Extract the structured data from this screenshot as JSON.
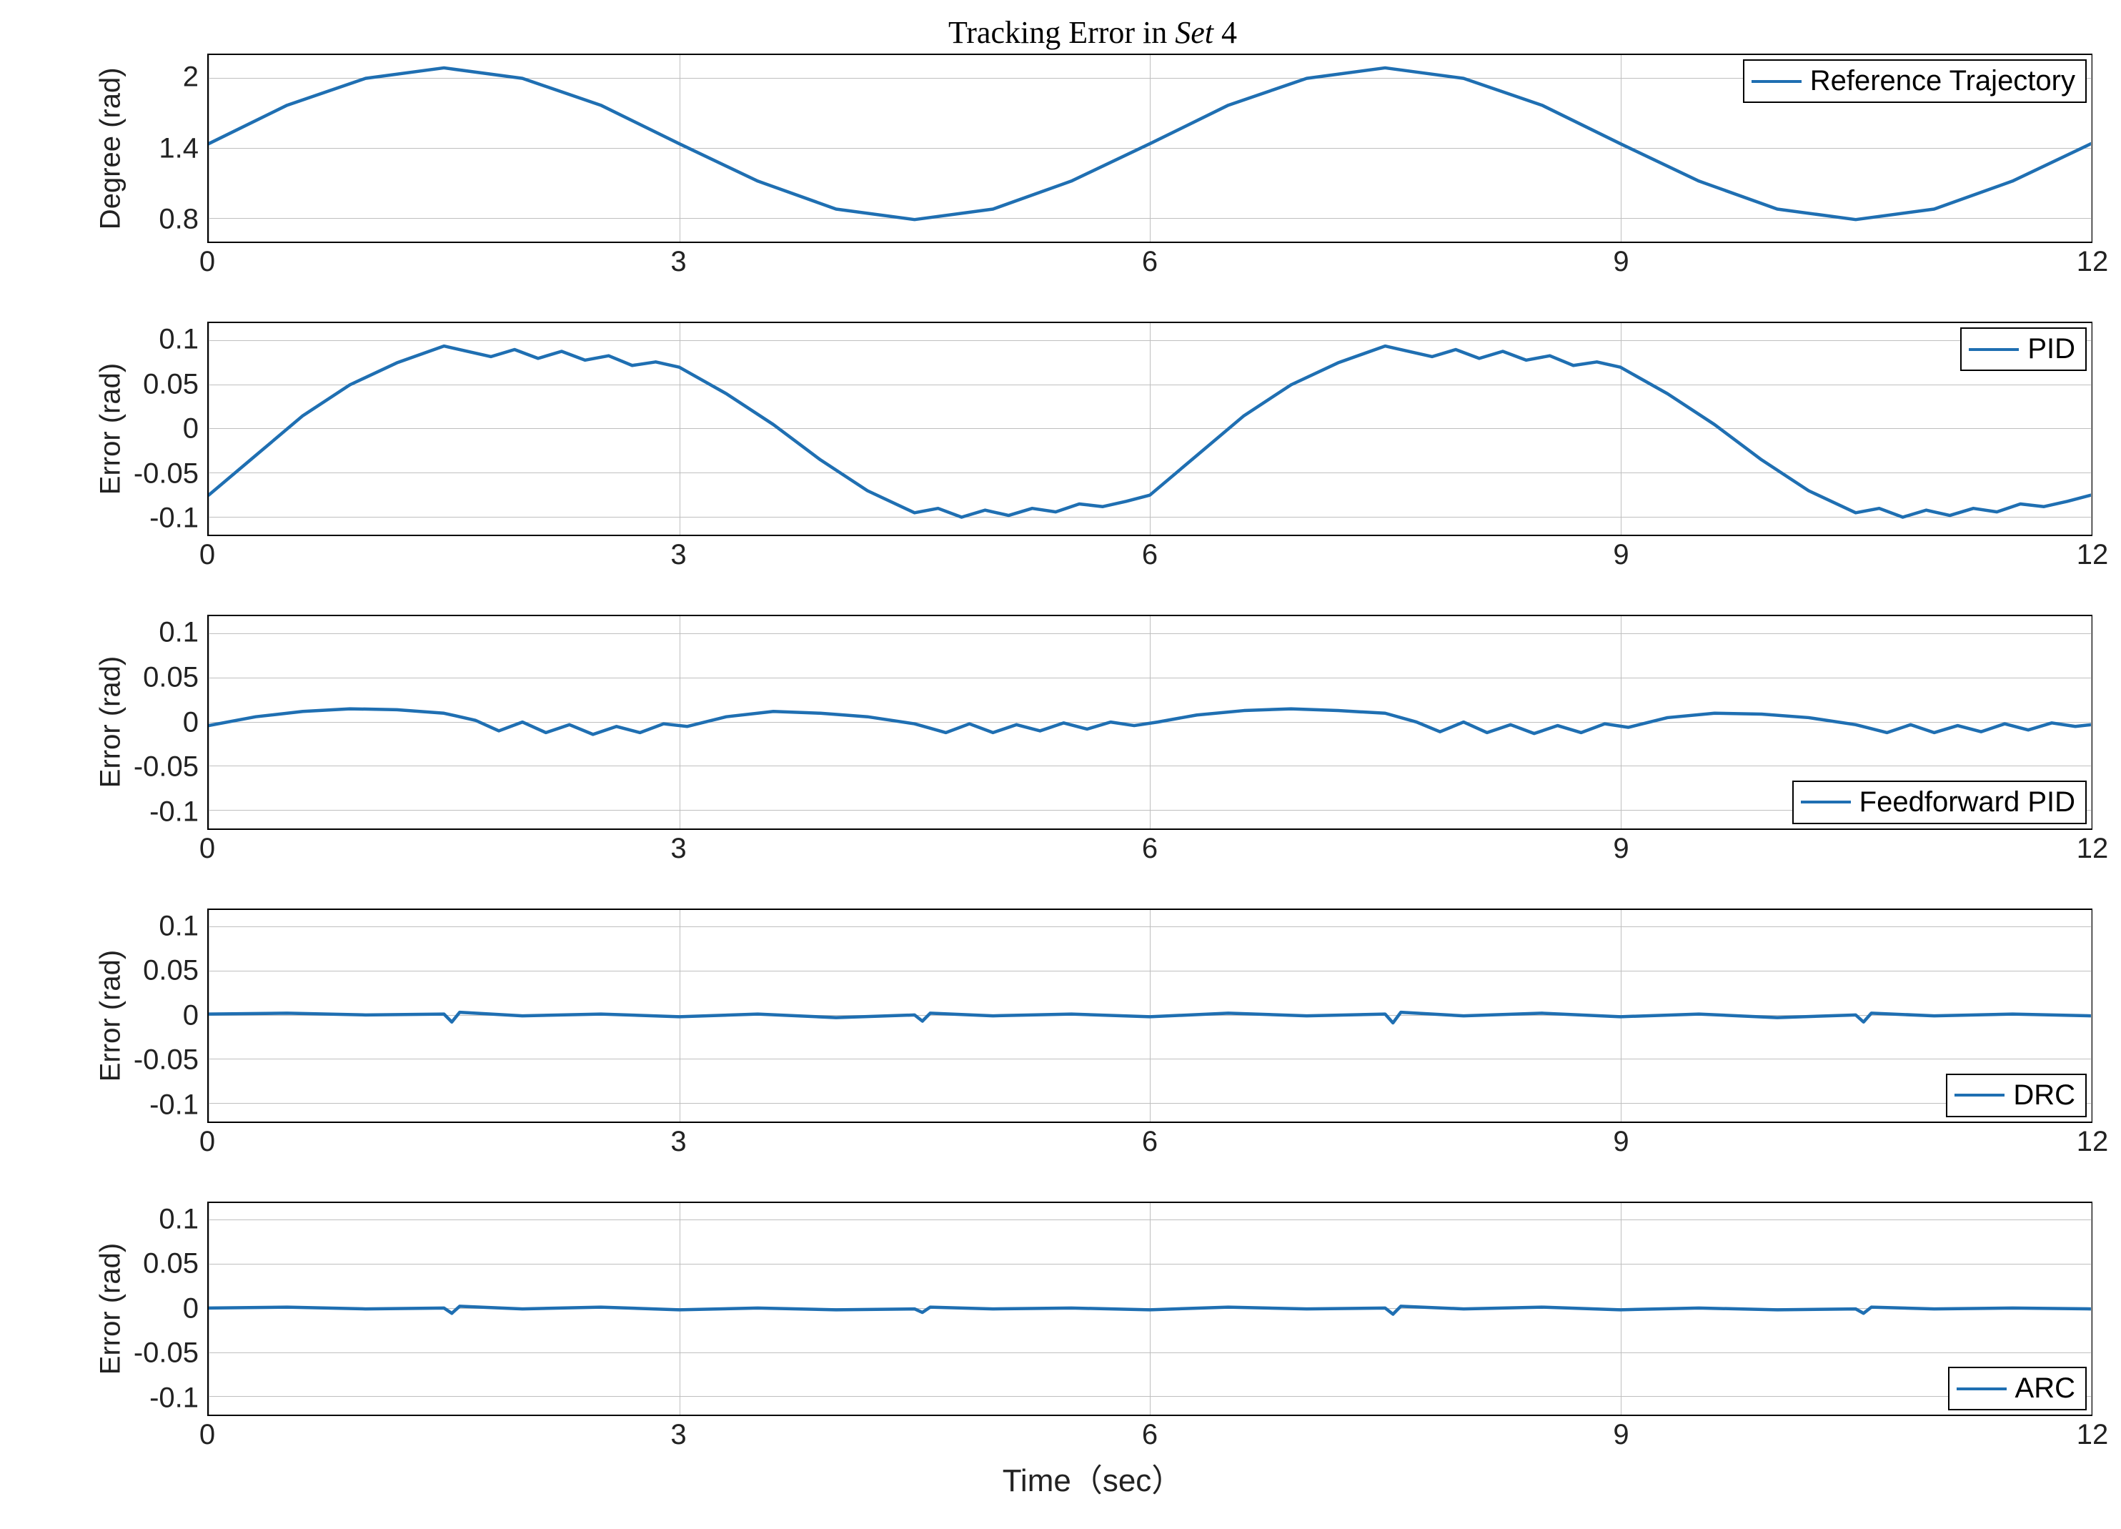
{
  "title_prefix": "Tracking Error in ",
  "title_set": "Set",
  "title_num": " 4",
  "xlabel": "Time（sec）",
  "colors": {
    "line": "#1f6fb2",
    "grid": "#bfbfbf",
    "axis": "#000000"
  },
  "xticks": [
    0,
    3,
    6,
    9,
    12
  ],
  "xlim": [
    0,
    12
  ],
  "panels": [
    {
      "id": "ref",
      "ylabel": "Degree (rad)",
      "legend": "Reference Trajectory",
      "yticks": [
        0.8,
        1.4,
        2
      ],
      "ylim": [
        0.6,
        2.2
      ],
      "legend_pos": "top"
    },
    {
      "id": "pid",
      "ylabel": "Error (rad)",
      "legend": "PID",
      "yticks": [
        -0.1,
        -0.05,
        0,
        0.05,
        0.1
      ],
      "ylim": [
        -0.12,
        0.12
      ],
      "legend_pos": "top"
    },
    {
      "id": "ff",
      "ylabel": "Error (rad)",
      "legend": "Feedforward PID",
      "yticks": [
        -0.1,
        -0.05,
        0,
        0.05,
        0.1
      ],
      "ylim": [
        -0.12,
        0.12
      ],
      "legend_pos": "bottom"
    },
    {
      "id": "drc",
      "ylabel": "Error (rad)",
      "legend": "DRC",
      "yticks": [
        -0.1,
        -0.05,
        0,
        0.05,
        0.1
      ],
      "ylim": [
        -0.12,
        0.12
      ],
      "legend_pos": "bottom"
    },
    {
      "id": "arc",
      "ylabel": "Error (rad)",
      "legend": "ARC",
      "yticks": [
        -0.1,
        -0.05,
        0,
        0.05,
        0.1
      ],
      "ylim": [
        -0.12,
        0.12
      ],
      "legend_pos": "bottom"
    }
  ],
  "chart_data": [
    {
      "type": "line",
      "title": "Reference Trajectory",
      "xlabel": "Time (sec)",
      "ylabel": "Degree (rad)",
      "xlim": [
        0,
        12
      ],
      "ylim": [
        0.6,
        2.2
      ],
      "x_step": 0.1,
      "formula": "1.44 + 0.65*sin(2*pi*t/6)",
      "series": [
        {
          "name": "Reference Trajectory",
          "x": [
            0,
            0.5,
            1,
            1.5,
            2,
            2.5,
            3,
            3.5,
            4,
            4.5,
            5,
            5.5,
            6,
            6.5,
            7,
            7.5,
            8,
            8.5,
            9,
            9.5,
            10,
            10.5,
            11,
            11.5,
            12
          ],
          "y": [
            1.44,
            1.77,
            2.0,
            2.09,
            2.0,
            1.77,
            1.44,
            1.12,
            0.88,
            0.79,
            0.88,
            1.12,
            1.44,
            1.77,
            2.0,
            2.09,
            2.0,
            1.77,
            1.44,
            1.12,
            0.88,
            0.79,
            0.88,
            1.12,
            1.44
          ]
        }
      ]
    },
    {
      "type": "line",
      "title": "PID",
      "xlabel": "Time (sec)",
      "ylabel": "Error (rad)",
      "xlim": [
        0,
        12
      ],
      "ylim": [
        -0.12,
        0.12
      ],
      "series": [
        {
          "name": "PID",
          "x": [
            0,
            0.3,
            0.6,
            0.9,
            1.2,
            1.5,
            1.6,
            1.8,
            1.95,
            2.1,
            2.25,
            2.4,
            2.55,
            2.7,
            2.85,
            3.0,
            3.3,
            3.6,
            3.9,
            4.2,
            4.5,
            4.65,
            4.8,
            4.95,
            5.1,
            5.25,
            5.4,
            5.55,
            5.7,
            5.85,
            6.0,
            6.3,
            6.6,
            6.9,
            7.2,
            7.5,
            7.6,
            7.8,
            7.95,
            8.1,
            8.25,
            8.4,
            8.55,
            8.7,
            8.85,
            9.0,
            9.3,
            9.6,
            9.9,
            10.2,
            10.5,
            10.65,
            10.8,
            10.95,
            11.1,
            11.25,
            11.4,
            11.55,
            11.7,
            11.85,
            12.0
          ],
          "y": [
            -0.075,
            -0.03,
            0.015,
            0.05,
            0.075,
            0.094,
            0.09,
            0.082,
            0.09,
            0.08,
            0.088,
            0.078,
            0.083,
            0.072,
            0.076,
            0.07,
            0.04,
            0.005,
            -0.035,
            -0.07,
            -0.095,
            -0.09,
            -0.1,
            -0.092,
            -0.098,
            -0.09,
            -0.094,
            -0.085,
            -0.088,
            -0.082,
            -0.075,
            -0.03,
            0.015,
            0.05,
            0.075,
            0.094,
            0.09,
            0.082,
            0.09,
            0.08,
            0.088,
            0.078,
            0.083,
            0.072,
            0.076,
            0.07,
            0.04,
            0.005,
            -0.035,
            -0.07,
            -0.095,
            -0.09,
            -0.1,
            -0.092,
            -0.098,
            -0.09,
            -0.094,
            -0.085,
            -0.088,
            -0.082,
            -0.075
          ]
        }
      ]
    },
    {
      "type": "line",
      "title": "Feedforward PID",
      "xlabel": "Time (sec)",
      "ylabel": "Error (rad)",
      "xlim": [
        0,
        12
      ],
      "ylim": [
        -0.12,
        0.12
      ],
      "series": [
        {
          "name": "Feedforward PID",
          "x": [
            0,
            0.3,
            0.6,
            0.9,
            1.2,
            1.5,
            1.7,
            1.85,
            2.0,
            2.15,
            2.3,
            2.45,
            2.6,
            2.75,
            2.9,
            3.05,
            3.3,
            3.6,
            3.9,
            4.2,
            4.5,
            4.7,
            4.85,
            5.0,
            5.15,
            5.3,
            5.45,
            5.6,
            5.75,
            5.9,
            6.05,
            6.3,
            6.6,
            6.9,
            7.2,
            7.5,
            7.7,
            7.85,
            8.0,
            8.15,
            8.3,
            8.45,
            8.6,
            8.75,
            8.9,
            9.05,
            9.3,
            9.6,
            9.9,
            10.2,
            10.5,
            10.7,
            10.85,
            11.0,
            11.15,
            11.3,
            11.45,
            11.6,
            11.75,
            11.9,
            12.0
          ],
          "y": [
            -0.004,
            0.006,
            0.012,
            0.015,
            0.014,
            0.01,
            0.002,
            -0.01,
            0.0,
            -0.012,
            -0.003,
            -0.014,
            -0.005,
            -0.012,
            -0.002,
            -0.005,
            0.006,
            0.012,
            0.01,
            0.006,
            -0.002,
            -0.012,
            -0.002,
            -0.012,
            -0.003,
            -0.01,
            -0.001,
            -0.008,
            0.0,
            -0.004,
            0.0,
            0.008,
            0.013,
            0.015,
            0.013,
            0.01,
            0.0,
            -0.011,
            0.0,
            -0.012,
            -0.003,
            -0.013,
            -0.004,
            -0.012,
            -0.002,
            -0.006,
            0.005,
            0.01,
            0.009,
            0.005,
            -0.003,
            -0.012,
            -0.003,
            -0.012,
            -0.004,
            -0.011,
            -0.002,
            -0.009,
            -0.001,
            -0.005,
            -0.003
          ]
        }
      ]
    },
    {
      "type": "line",
      "title": "DRC",
      "xlabel": "Time (sec)",
      "ylabel": "Error (rad)",
      "xlim": [
        0,
        12
      ],
      "ylim": [
        -0.12,
        0.12
      ],
      "series": [
        {
          "name": "DRC",
          "x": [
            0,
            0.5,
            1,
            1.5,
            1.55,
            1.6,
            2,
            2.5,
            3,
            3.5,
            4,
            4.5,
            4.55,
            4.6,
            5,
            5.5,
            6,
            6.5,
            7,
            7.5,
            7.55,
            7.6,
            8,
            8.5,
            9,
            9.5,
            10,
            10.5,
            10.55,
            10.6,
            11,
            11.5,
            12
          ],
          "y": [
            0.002,
            0.003,
            0.001,
            0.002,
            -0.007,
            0.004,
            0.0,
            0.002,
            -0.001,
            0.002,
            -0.002,
            0.001,
            -0.006,
            0.003,
            0.0,
            0.002,
            -0.001,
            0.003,
            0.0,
            0.002,
            -0.008,
            0.004,
            0.0,
            0.003,
            -0.001,
            0.002,
            -0.002,
            0.001,
            -0.007,
            0.003,
            0.0,
            0.002,
            0.0
          ]
        }
      ]
    },
    {
      "type": "line",
      "title": "ARC",
      "xlabel": "Time (sec)",
      "ylabel": "Error (rad)",
      "xlim": [
        0,
        12
      ],
      "ylim": [
        -0.12,
        0.12
      ],
      "series": [
        {
          "name": "ARC",
          "x": [
            0,
            0.5,
            1,
            1.5,
            1.55,
            1.6,
            2,
            2.5,
            3,
            3.5,
            4,
            4.5,
            4.55,
            4.6,
            5,
            5.5,
            6,
            6.5,
            7,
            7.5,
            7.55,
            7.6,
            8,
            8.5,
            9,
            9.5,
            10,
            10.5,
            10.55,
            10.6,
            11,
            11.5,
            12
          ],
          "y": [
            0.001,
            0.002,
            0.0,
            0.001,
            -0.005,
            0.003,
            0.0,
            0.002,
            -0.001,
            0.001,
            -0.001,
            0.0,
            -0.004,
            0.002,
            0.0,
            0.001,
            -0.001,
            0.002,
            0.0,
            0.001,
            -0.006,
            0.003,
            0.0,
            0.002,
            -0.001,
            0.001,
            -0.001,
            0.0,
            -0.005,
            0.002,
            0.0,
            0.001,
            0.0
          ]
        }
      ]
    }
  ]
}
